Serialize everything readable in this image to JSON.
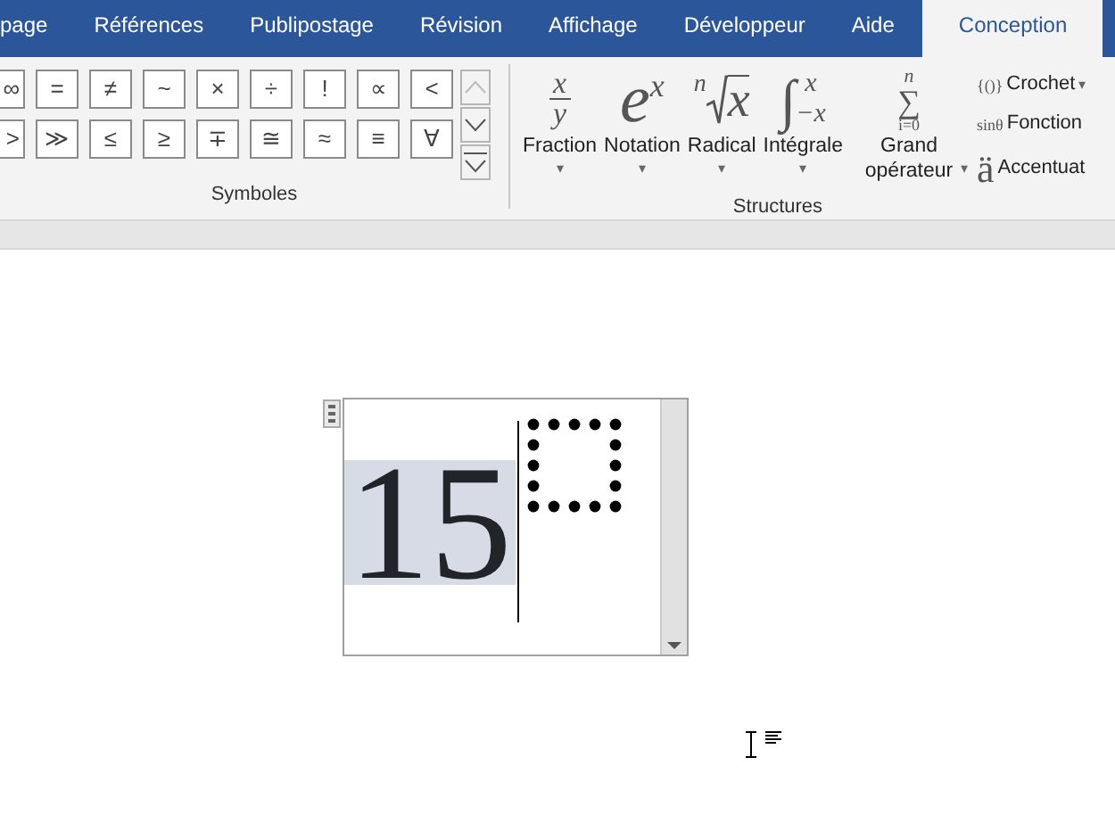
{
  "tabs": [
    {
      "label": "page",
      "selected": false
    },
    {
      "label": "Références",
      "selected": false
    },
    {
      "label": "Publipostage",
      "selected": false
    },
    {
      "label": "Révision",
      "selected": false
    },
    {
      "label": "Affichage",
      "selected": false
    },
    {
      "label": "Développeur",
      "selected": false
    },
    {
      "label": "Aide",
      "selected": false
    },
    {
      "label": "Conception",
      "selected": true
    }
  ],
  "symbols": {
    "rows": [
      [
        "∞",
        "=",
        "≠",
        "~",
        "×",
        "÷",
        "!",
        "∝",
        "<"
      ],
      [
        ">",
        "≫",
        "≤",
        "≥",
        "∓",
        "≅",
        "≈",
        "≡",
        "∀"
      ]
    ],
    "label": "Symboles"
  },
  "structures": {
    "large": [
      {
        "kind": "fraction",
        "parts": [
          "x",
          "y"
        ],
        "label": "Fraction",
        "caret": "▾"
      },
      {
        "kind": "script",
        "parts": [
          "e",
          "x"
        ],
        "label": "Notation",
        "caret": "▾"
      },
      {
        "kind": "radical",
        "parts": [
          "n",
          "x"
        ],
        "label": "Radical",
        "caret": "▾"
      },
      {
        "kind": "integral",
        "parts": [
          "∫",
          "x",
          "−x"
        ],
        "label": "Intégrale",
        "caret": "▾"
      },
      {
        "kind": "sum",
        "parts": [
          "n",
          "∑",
          "i=0"
        ],
        "label": "Grand opérateur",
        "caret": "▾"
      }
    ],
    "small": [
      {
        "icon": "{()}",
        "label": "Crochet",
        "caret": "▾"
      },
      {
        "icon": "sinθ",
        "label": "Fonction"
      },
      {
        "icon": "ä",
        "label": "Accentuat"
      }
    ],
    "label": "Structures"
  },
  "equation": {
    "selected_text": "15",
    "placeholder_selected": false
  }
}
